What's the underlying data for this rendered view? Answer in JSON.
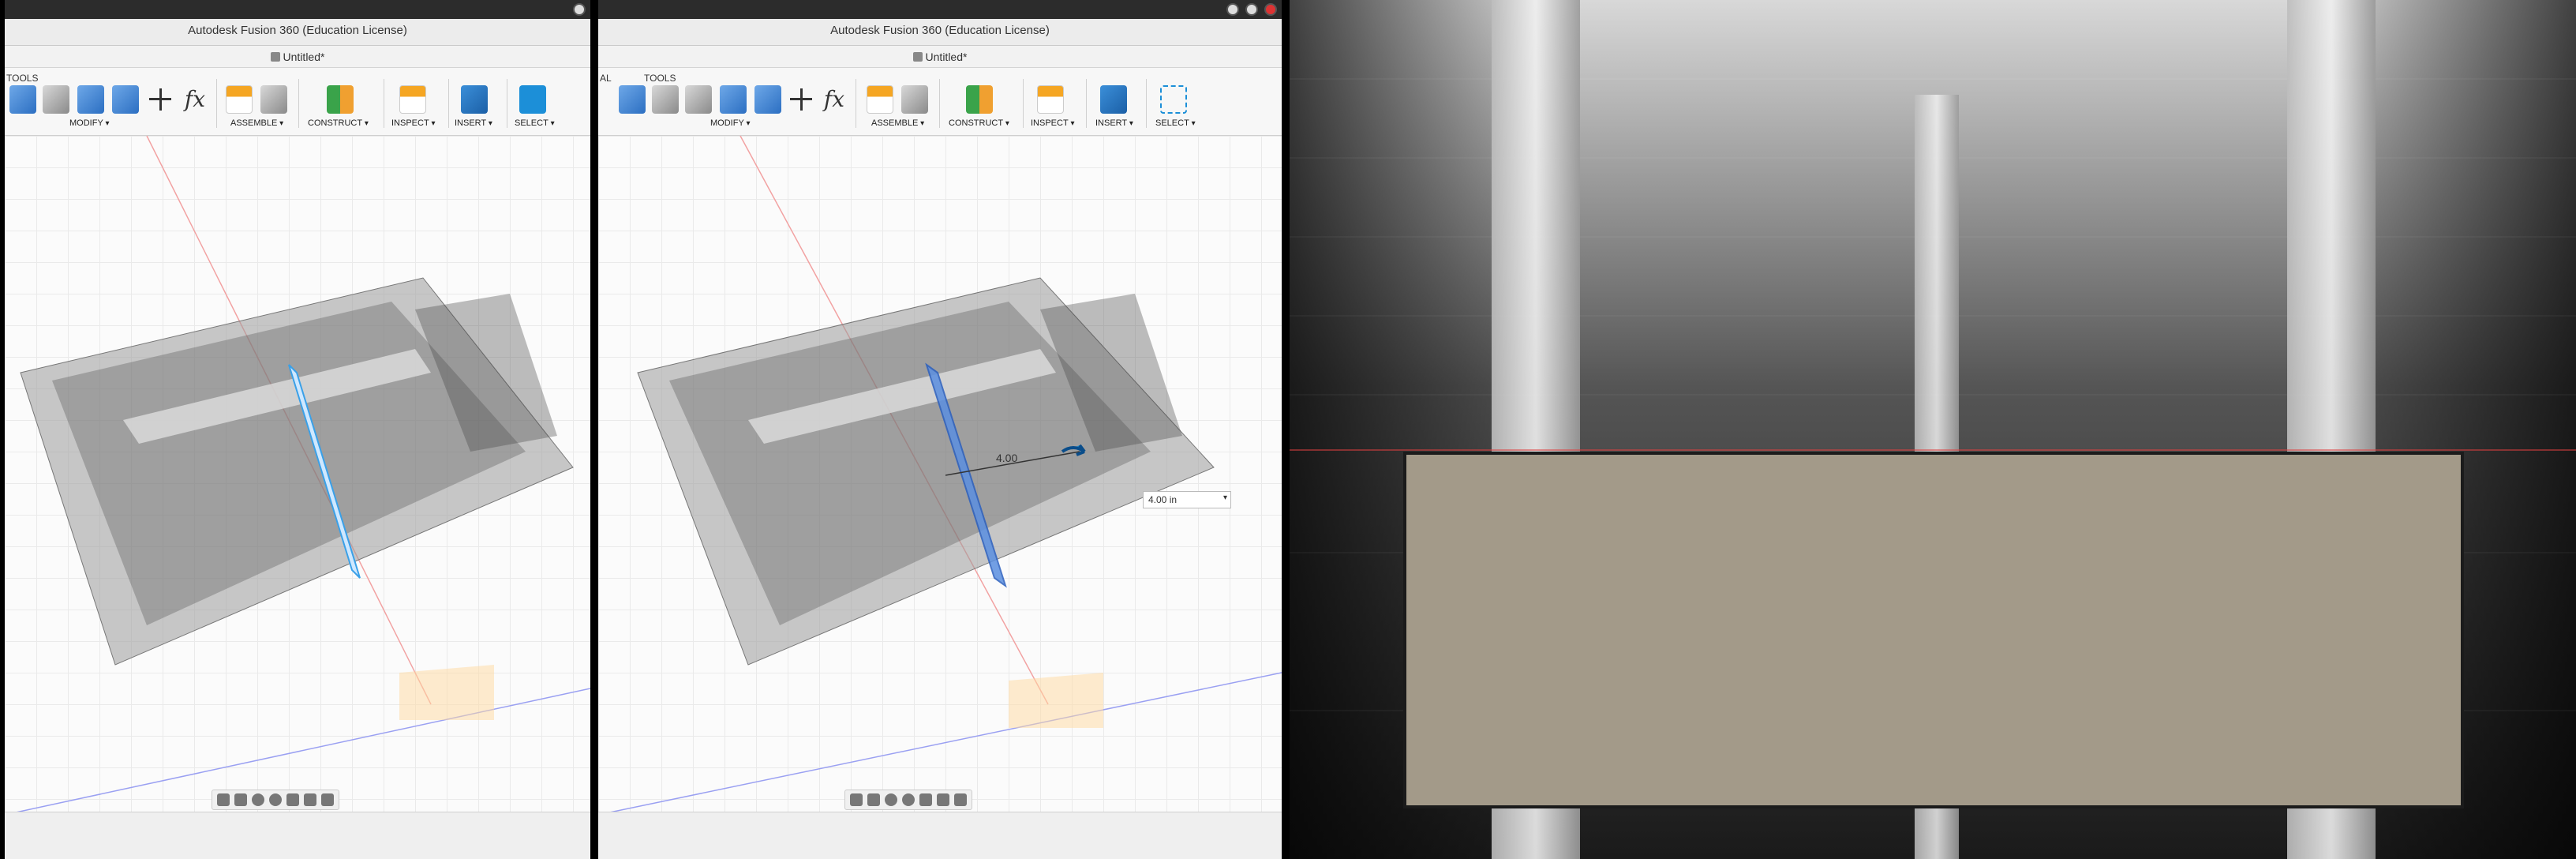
{
  "window": {
    "title": "Autodesk Fusion 360 (Education License)",
    "document_tab": "Untitled*"
  },
  "toolbar": {
    "tools_label": "TOOLS",
    "tools_label_partial": "AL",
    "groups": {
      "modify": "MODIFY",
      "assemble": "ASSEMBLE",
      "construct": "CONSTRUCT",
      "inspect": "INSPECT",
      "insert": "INSERT",
      "select": "SELECT"
    },
    "icons": [
      "fillet-icon",
      "shell-icon",
      "combine-icon",
      "offset-face-icon",
      "move-icon",
      "parameters-icon",
      "new-component-icon",
      "joint-icon",
      "midplane-icon",
      "measure-icon",
      "insert-image-icon",
      "select-icon"
    ]
  },
  "manipulator": {
    "distance_label": "4.00",
    "distance_value": "4.00 in"
  },
  "colors": {
    "accent": "#1c8fd8",
    "plane_fill": "#5b8fe0",
    "product_fill": "#a39a89",
    "dark_bg": "#1f1f1f"
  }
}
